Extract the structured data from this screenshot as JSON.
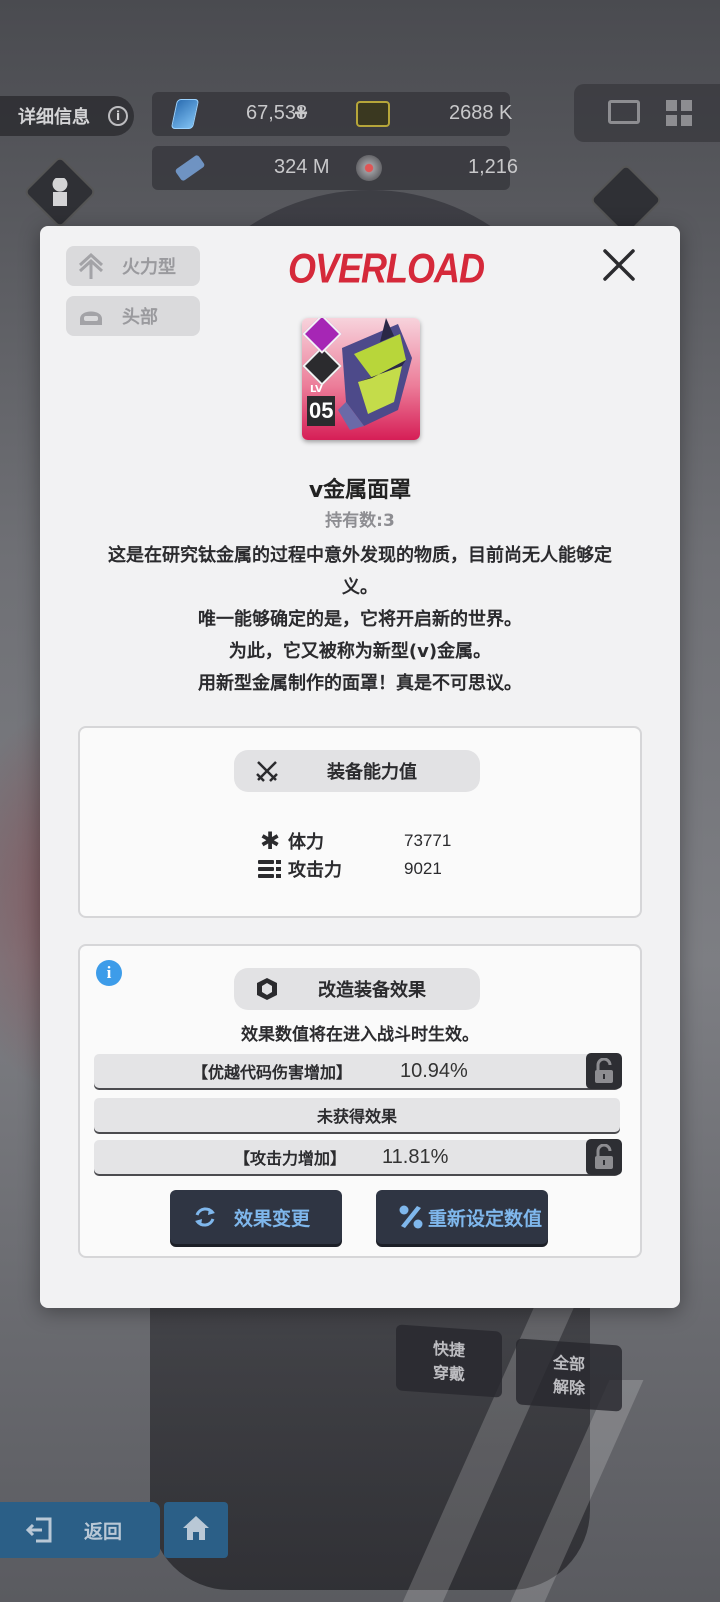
{
  "hud": {
    "detail_label": "详细信息",
    "info_glyph": "i",
    "resources": [
      {
        "icon": "gem-card-icon",
        "value": "67,538",
        "has_add": true,
        "add_label": "+"
      },
      {
        "icon": "credit-chip-icon",
        "value": "2688 K"
      },
      {
        "icon": "battle-data-icon",
        "value": "324 M"
      },
      {
        "icon": "core-dust-icon",
        "value": "1,216"
      }
    ],
    "mail_icon": "mail-icon",
    "grid_icon": "grid-menu-icon"
  },
  "modal": {
    "tags": [
      {
        "icon": "firepower-type-icon",
        "label": "火力型"
      },
      {
        "icon": "helmet-head-icon",
        "label": "头部"
      }
    ],
    "logo_text": "OVERLOAD",
    "close_icon": "close-icon",
    "item": {
      "level_prefix": "LV",
      "level": "05",
      "name": "v金属面罩",
      "count_text": "持有数:3"
    },
    "description": [
      "这是在研究钛金属的过程中意外发现的物质，目前尚无人能够定",
      "义。",
      "唯一能够确定的是，它将开启新的世界。",
      "为此，它又被称为新型(v)金属。",
      "用新型金属制作的面罩！真是不可思议。"
    ],
    "equip_stats": {
      "title": "装备能力值",
      "title_icon": "crossed-swords-icon",
      "stats": [
        {
          "icon": "hp-star-icon",
          "label": "体力",
          "value": "73771"
        },
        {
          "icon": "attack-bullets-icon",
          "label": "攻击力",
          "value": "9021"
        }
      ]
    },
    "effects": {
      "info_glyph": "i",
      "title": "改造装备效果",
      "title_icon": "module-cube-icon",
      "note": "效果数值将在进入战斗时生效。",
      "rows": [
        {
          "name": "【优越代码伤害增加】",
          "value": "10.94%",
          "locked": false
        },
        {
          "name": "未获得效果",
          "value": "",
          "locked": null
        },
        {
          "name": "【攻击力增加】",
          "value": "11.81%",
          "locked": false
        }
      ],
      "buttons": [
        {
          "icon": "refresh-icon",
          "label": "效果变更"
        },
        {
          "icon": "percent-icon",
          "label": "重新设定数值"
        }
      ]
    }
  },
  "bottom": {
    "quick_equip": "快捷\n穿戴",
    "remove_all": "全部\n解除",
    "back_label": "返回",
    "back_icon": "back-exit-icon",
    "home_icon": "home-icon"
  },
  "colors": {
    "overload_red": "#d5293a",
    "button_bg": "#2f3543",
    "button_text": "#7fb7ec",
    "info_blue": "#3d9ce9",
    "nav_blue": "#2b5f87"
  }
}
